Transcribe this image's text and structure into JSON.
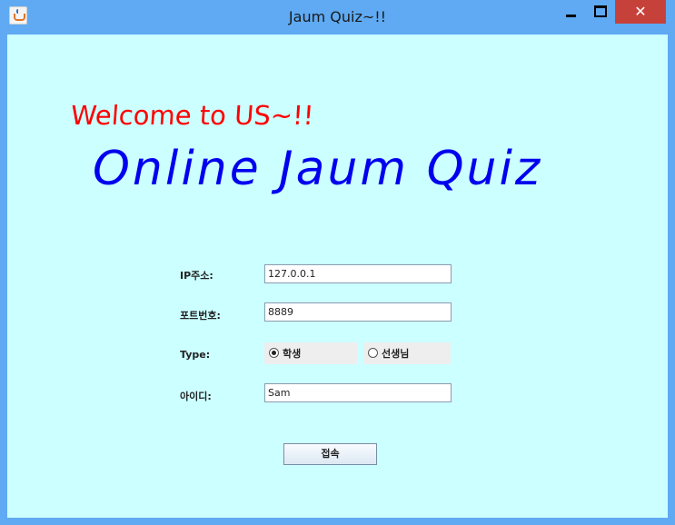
{
  "window": {
    "title": "Jaum Quiz~!!",
    "close_glyph": "✕",
    "icons": [
      "java-app-icon",
      "minimize-icon",
      "maximize-icon",
      "close-icon"
    ],
    "colors": {
      "titlebar": "#5faaf3",
      "client_bg": "#ccffff",
      "close": "#c7413b"
    }
  },
  "banner": {
    "welcome": "Welcome to US~!!",
    "headline": "Online Jaum Quiz",
    "welcome_color": "#ff0000",
    "headline_color": "#0000ee"
  },
  "form": {
    "ip_label": "IP주소:",
    "ip_value": "127.0.0.1",
    "port_label": "포트번호:",
    "port_value": "8889",
    "type_label": "Type:",
    "type_options": [
      {
        "label": "학생",
        "selected": true
      },
      {
        "label": "선생님",
        "selected": false
      }
    ],
    "id_label": "아이디:",
    "id_value": "Sam",
    "connect_label": "접속"
  }
}
